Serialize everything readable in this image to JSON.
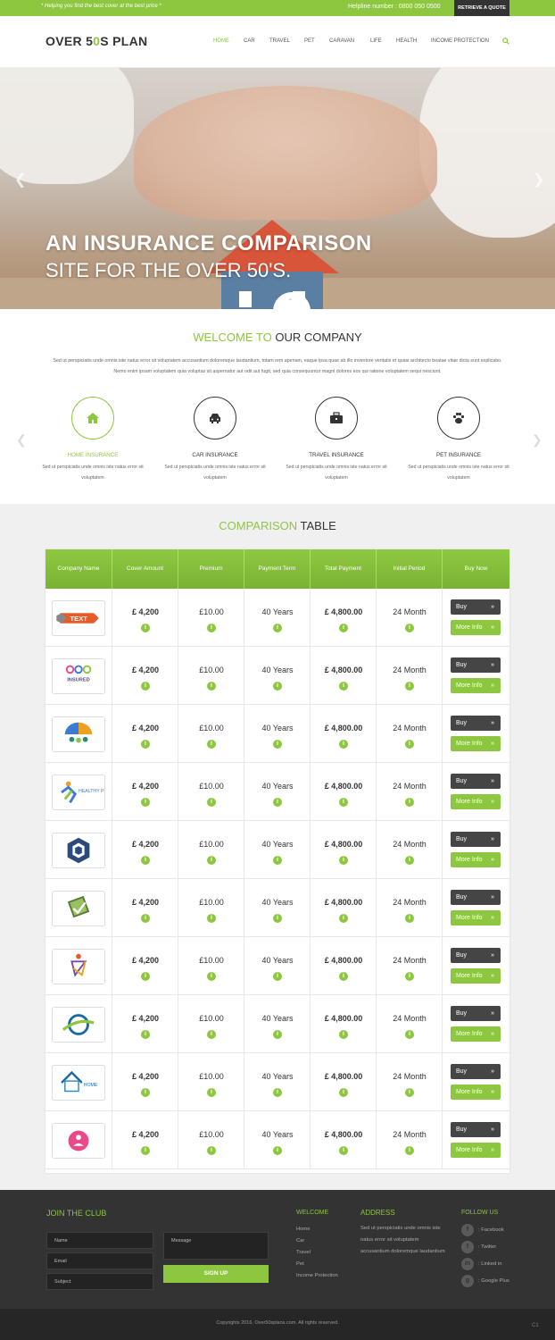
{
  "topbar": {
    "tagline": "* Helping you find the best cover at the best price *",
    "helpline": "Helpline number : 0800 050 0500",
    "quote_button": "RETRIEVE A QUOTE"
  },
  "header": {
    "logo_a": "OVER 5",
    "logo_o": "0",
    "logo_b": "S PLAN",
    "nav": [
      "HOME",
      "CAR",
      "TRAVEL",
      "PET",
      "CARAVAN",
      "LIFE",
      "HEALTH",
      "INCOME PROTECTION"
    ],
    "active_nav": "HOME"
  },
  "hero": {
    "title": "AN INSURANCE COMPARISON",
    "subtitle": "SITE FOR THE OVER 50'S."
  },
  "welcome": {
    "title_green": "WELCOME TO",
    "title_dark": "OUR COMPANY",
    "text": "Sed ut perspiciatis unde omnis iste natus error sit voluptatem accusantium doloremque laudantium, totam rem aperiam, eaque ipsa quae ab illo inventore veritatis et quasi architecto beatae vitae dicta sunt explicabo. Nemo enim ipsam voluptatem quia voluptas sit aspernatur aut odit aut fugit, sed quia consequuntur magni dolores eos qui ratione voluptatem sequi nesciunt.",
    "services": [
      {
        "name": "HOME INSURANCE",
        "desc": "Sed ut perspiciatis unde omnis iste natus error sit voluptatem",
        "icon": "home-icon"
      },
      {
        "name": "CAR INSURANCE",
        "desc": "Sed ut perspiciatis unde omnis iste natus error sit voluptatem",
        "icon": "car-icon"
      },
      {
        "name": "TRAVEL INSURANCE",
        "desc": "Sed ut perspiciatis unde omnis iste natus error sit voluptatem",
        "icon": "briefcase-icon"
      },
      {
        "name": "PET INSURANCE",
        "desc": "Sed ut perspiciatis unde omnis iste natus error sit voluptatem",
        "icon": "paw-icon"
      }
    ]
  },
  "comparison": {
    "title_green": "COMPARISON",
    "title_dark": "TABLE",
    "headers": [
      "Company Name",
      "Cover Amount",
      "Premium",
      "Payment Term",
      "Total Payment",
      "Initial Period",
      "Buy Now"
    ],
    "buy_label": "Buy",
    "more_label": "More Info",
    "rows": [
      {
        "logo": "text-logo",
        "logo_text": "TEXT",
        "cover": "£ 4,200",
        "premium": "£10.00",
        "term": "40 Years",
        "total": "£ 4,800.00",
        "period": "24 Month"
      },
      {
        "logo": "insured-logo",
        "logo_text": "INSURED",
        "cover": "£ 4,200",
        "premium": "£10.00",
        "term": "40 Years",
        "total": "£ 4,800.00",
        "period": "24 Month"
      },
      {
        "logo": "umbrella-family-logo",
        "logo_text": "",
        "cover": "£ 4,200",
        "premium": "£10.00",
        "term": "40 Years",
        "total": "£ 4,800.00",
        "period": "24 Month"
      },
      {
        "logo": "healthy-people-logo",
        "logo_text": "HEALTHY PEOPLE",
        "cover": "£ 4,200",
        "premium": "£10.00",
        "term": "40 Years",
        "total": "£ 4,800.00",
        "period": "24 Month"
      },
      {
        "logo": "hexagon-logo",
        "logo_text": "",
        "cover": "£ 4,200",
        "premium": "£10.00",
        "term": "40 Years",
        "total": "£ 4,800.00",
        "period": "24 Month"
      },
      {
        "logo": "shield-check-logo",
        "logo_text": "",
        "cover": "£ 4,200",
        "premium": "£10.00",
        "term": "40 Years",
        "total": "£ 4,800.00",
        "period": "24 Month"
      },
      {
        "logo": "people-circle-logo",
        "logo_text": "",
        "cover": "£ 4,200",
        "premium": "£10.00",
        "term": "40 Years",
        "total": "£ 4,800.00",
        "period": "24 Month"
      },
      {
        "logo": "swoosh-globe-logo",
        "logo_text": "",
        "cover": "£ 4,200",
        "premium": "£10.00",
        "term": "40 Years",
        "total": "£ 4,800.00",
        "period": "24 Month"
      },
      {
        "logo": "home-roof-logo",
        "logo_text": "HOME",
        "cover": "£ 4,200",
        "premium": "£10.00",
        "term": "40 Years",
        "total": "£ 4,800.00",
        "period": "24 Month"
      },
      {
        "logo": "pink-circle-logo",
        "logo_text": "",
        "cover": "£ 4,200",
        "premium": "£10.00",
        "term": "40 Years",
        "total": "£ 4,800.00",
        "period": "24 Month"
      }
    ]
  },
  "footer": {
    "join_title": "JOIN THE CLUB",
    "name_placeholder": "Name",
    "email_placeholder": "Email",
    "subject_placeholder": "Subject",
    "message_placeholder": "Message",
    "signup_label": "SIGN UP",
    "welcome_title": "WELCOME",
    "links": [
      "Home",
      "Car",
      "Travel",
      "Pet",
      "Income Protection"
    ],
    "address_title": "ADDRESS",
    "address_text": "Sed ut perspiciatis unde omnis iste natus error sit voluptatem accusantium doloremque laudantium",
    "follow_title": "FOLLOW US",
    "social": [
      {
        "label": ": Facebook",
        "icon": "facebook-icon"
      },
      {
        "label": ": Twitter",
        "icon": "twitter-icon"
      },
      {
        "label": ": Linked in",
        "icon": "linkedin-icon"
      },
      {
        "label": ": Google Plus",
        "icon": "google-plus-icon"
      }
    ],
    "copyright": "Copyrights  2016. Over50splans.com.  All rights reserved.",
    "corner": "C1"
  },
  "colors": {
    "accent": "#8dc63f",
    "dark": "#333333",
    "button_dark": "#454545"
  }
}
